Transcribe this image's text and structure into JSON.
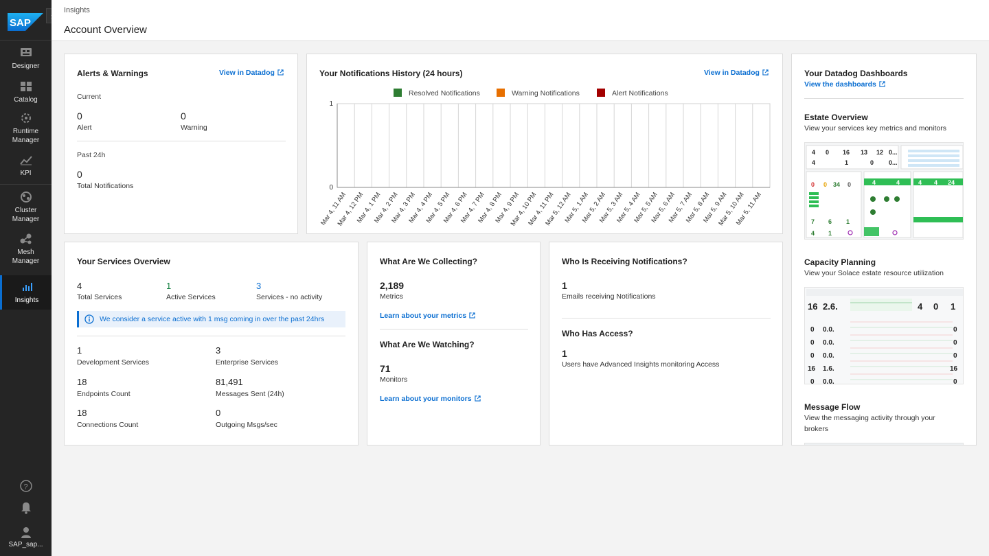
{
  "sidebar": {
    "logo_text": "SAP",
    "items": [
      {
        "label_1": "Designer",
        "label_2": "",
        "icon": "designer-icon"
      },
      {
        "label_1": "Catalog",
        "label_2": "",
        "icon": "catalog-icon"
      },
      {
        "label_1": "Runtime",
        "label_2": "Manager",
        "icon": "runtime-icon"
      },
      {
        "label_1": "KPI",
        "label_2": "",
        "icon": "kpi-icon"
      },
      {
        "label_1": "Cluster",
        "label_2": "Manager",
        "icon": "cluster-icon"
      },
      {
        "label_1": "Mesh",
        "label_2": "Manager",
        "icon": "mesh-icon"
      },
      {
        "label_1": "Insights",
        "label_2": "",
        "icon": "insights-icon"
      }
    ],
    "user_label": "SAP_sap..."
  },
  "header": {
    "breadcrumb": "Insights",
    "title": "Account Overview"
  },
  "alerts": {
    "title": "Alerts & Warnings",
    "link": "View in Datadog",
    "current_label": "Current",
    "alert_value": "0",
    "alert_label": "Alert",
    "warning_value": "0",
    "warning_label": "Warning",
    "past_label": "Past 24h",
    "total_value": "0",
    "total_label": "Total Notifications"
  },
  "history": {
    "title": "Your Notifications History (24 hours)",
    "link": "View in Datadog"
  },
  "chart_data": {
    "type": "bar",
    "title": "Your Notifications History (24 hours)",
    "xlabel": "",
    "ylabel": "",
    "ylim": [
      0,
      1
    ],
    "yticks": [
      "0",
      "1"
    ],
    "legend_position": "top",
    "grid": true,
    "categories": [
      "Mar 4, 11 AM",
      "Mar 4, 12 PM",
      "Mar 4, 1 PM",
      "Mar 4, 2 PM",
      "Mar 4, 3 PM",
      "Mar 4, 4 PM",
      "Mar 4, 5 PM",
      "Mar 4, 6 PM",
      "Mar 4, 7 PM",
      "Mar 4, 8 PM",
      "Mar 4, 9 PM",
      "Mar 4, 10 PM",
      "Mar 4, 11 PM",
      "Mar 5, 12 AM",
      "Mar 5, 1 AM",
      "Mar 5, 2 AM",
      "Mar 5, 3 AM",
      "Mar 5, 4 AM",
      "Mar 5, 5 AM",
      "Mar 5, 6 AM",
      "Mar 5, 7 AM",
      "Mar 5, 8 AM",
      "Mar 5, 9 AM",
      "Mar 5, 10 AM",
      "Mar 5, 11 AM"
    ],
    "series": [
      {
        "name": "Resolved Notifications",
        "color": "#2e7d32",
        "values": [
          0,
          0,
          0,
          0,
          0,
          0,
          0,
          0,
          0,
          0,
          0,
          0,
          0,
          0,
          0,
          0,
          0,
          0,
          0,
          0,
          0,
          0,
          0,
          0,
          0
        ]
      },
      {
        "name": "Warning Notifications",
        "color": "#e76f00",
        "values": [
          0,
          0,
          0,
          0,
          0,
          0,
          0,
          0,
          0,
          0,
          0,
          0,
          0,
          0,
          0,
          0,
          0,
          0,
          0,
          0,
          0,
          0,
          0,
          0,
          0
        ]
      },
      {
        "name": "Alert Notifications",
        "color": "#a30000",
        "values": [
          0,
          0,
          0,
          0,
          0,
          0,
          0,
          0,
          0,
          0,
          0,
          0,
          0,
          0,
          0,
          0,
          0,
          0,
          0,
          0,
          0,
          0,
          0,
          0,
          0
        ]
      }
    ]
  },
  "dashboards": {
    "title": "Your Datadog Dashboards",
    "link": "View the dashboards",
    "items": [
      {
        "title": "Estate Overview",
        "desc": "View your services key metrics and monitors"
      },
      {
        "title": "Capacity Planning",
        "desc": "View your Solace estate resource utilization"
      },
      {
        "title": "Message Flow",
        "desc_1": "View the messaging activity through your",
        "desc_2": "brokers"
      }
    ],
    "estate_thumb": {
      "top_nums": [
        "4",
        "0",
        "16",
        "13",
        "12",
        "0...",
        "4",
        "1",
        "0",
        "0..."
      ],
      "mid_nums": [
        "0",
        "0",
        "34",
        "0",
        "4",
        "4",
        "4",
        "4",
        "24"
      ],
      "low_nums": [
        "7",
        "6",
        "1",
        "4",
        "1",
        "4"
      ]
    },
    "capacity_thumb": {
      "rows": [
        [
          "16",
          "2.6.",
          "4",
          "0",
          "1"
        ],
        [
          "0",
          "0.0.",
          "0"
        ],
        [
          "0",
          "0.0.",
          "0"
        ],
        [
          "0",
          "0.0.",
          "0"
        ],
        [
          "16",
          "1.6.",
          "16"
        ],
        [
          "0",
          "0.0.",
          "0"
        ]
      ]
    }
  },
  "services": {
    "title": "Your Services Overview",
    "total_value": "4",
    "total_label": "Total Services",
    "active_value": "1",
    "active_label": "Active Services",
    "noact_value": "3",
    "noact_label": "Services - no activity",
    "info": "We consider a service active with 1 msg coming in over the past 24hrs",
    "dev_value": "1",
    "dev_label": "Development Services",
    "ent_value": "3",
    "ent_label": "Enterprise Services",
    "endpoints_value": "18",
    "endpoints_label": "Endpoints Count",
    "msgs_value": "81,491",
    "msgs_label": "Messages Sent (24h)",
    "conn_value": "18",
    "conn_label": "Connections Count",
    "out_value": "0",
    "out_label": "Outgoing Msgs/sec"
  },
  "collecting": {
    "title": "What Are We Collecting?",
    "metrics_value": "2,189",
    "metrics_label": "Metrics",
    "metrics_link": "Learn about your metrics",
    "watch_title": "What Are We Watching?",
    "monitors_value": "71",
    "monitors_label": "Monitors",
    "monitors_link": "Learn about your monitors"
  },
  "receiving": {
    "title": "Who Is Receiving Notifications?",
    "emails_value": "1",
    "emails_label": "Emails receiving Notifications",
    "access_title": "Who Has Access?",
    "users_value": "1",
    "users_label": "Users have Advanced Insights monitoring Access"
  }
}
